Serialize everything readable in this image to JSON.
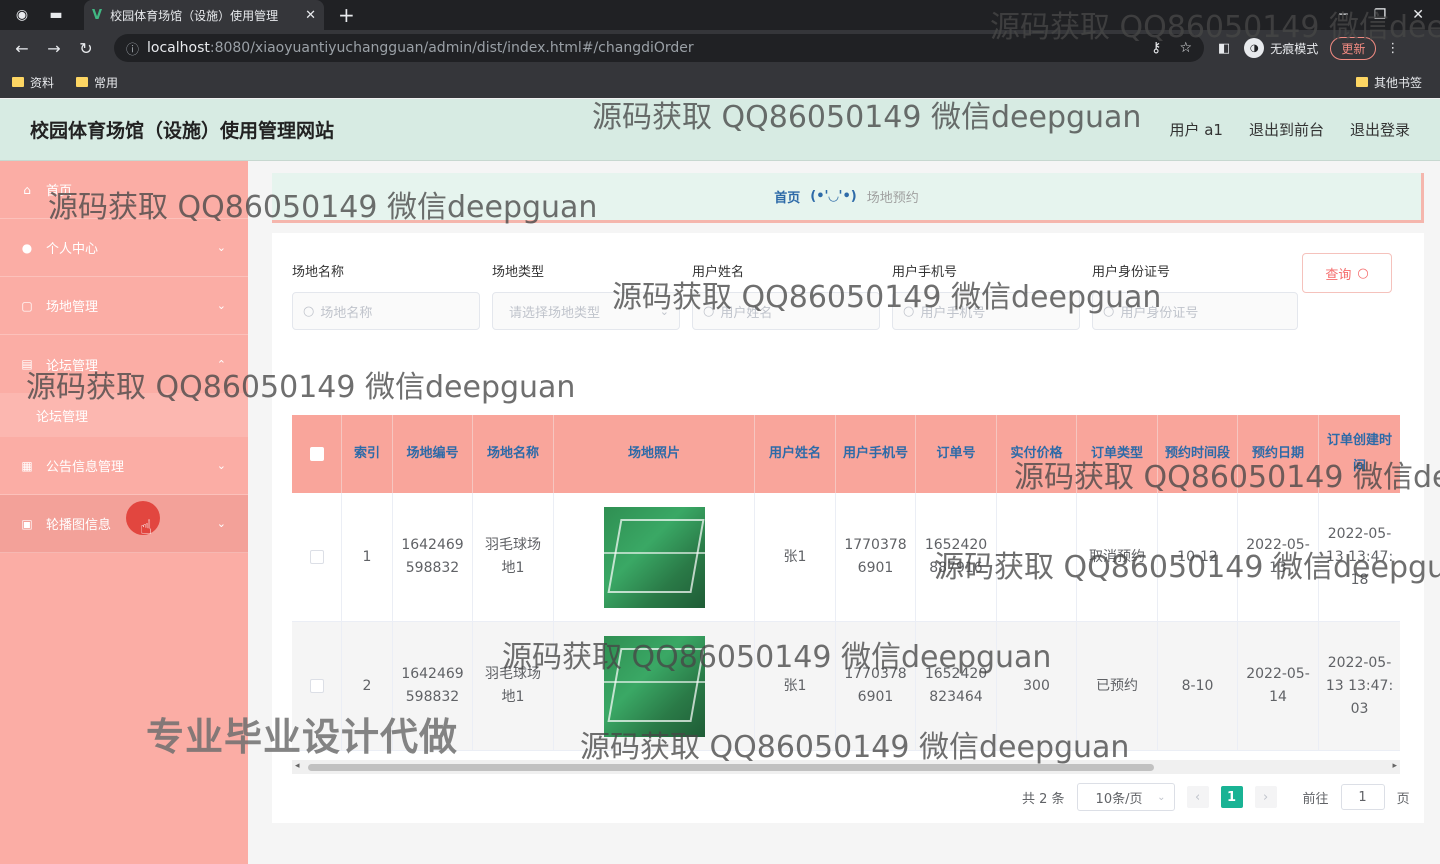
{
  "browser": {
    "tab_title": "校园体育场馆（设施）使用管理",
    "url_host": "localhost",
    "url_path": ":8080/xiaoyuantiyuchangguan/admin/dist/index.html#/changdiOrder",
    "incognito_label": "无痕模式",
    "update_label": "更新",
    "bookmarks": [
      "资料",
      "常用"
    ],
    "other_bookmarks": "其他书签"
  },
  "header": {
    "site_title": "校园体育场馆（设施）使用管理网站",
    "user_label": "用户 a1",
    "back_label": "退出到前台",
    "logout_label": "退出登录"
  },
  "sidebar": {
    "items": [
      {
        "label": "首页",
        "icon": "home-icon"
      },
      {
        "label": "个人中心",
        "icon": "user-icon"
      },
      {
        "label": "场地管理",
        "icon": "venue-icon"
      },
      {
        "label": "论坛管理",
        "icon": "forum-icon"
      },
      {
        "label": "公告信息管理",
        "icon": "grid-icon"
      },
      {
        "label": "轮播图信息",
        "icon": "image-icon"
      }
    ],
    "sub_item": "论坛管理"
  },
  "breadcrumb": {
    "home": "首页",
    "face": "(•'◡'•)",
    "current": "场地预约"
  },
  "filters": [
    {
      "label": "场地名称",
      "placeholder": "场地名称"
    },
    {
      "label": "场地类型",
      "placeholder": "请选择场地类型"
    },
    {
      "label": "用户姓名",
      "placeholder": "用户姓名"
    },
    {
      "label": "用户手机号",
      "placeholder": "用户手机号"
    },
    {
      "label": "用户身份证号",
      "placeholder": "用户身份证号"
    }
  ],
  "query_label": "查询",
  "table": {
    "headers": [
      "索引",
      "场地编号",
      "场地名称",
      "场地照片",
      "用户姓名",
      "用户手机号",
      "订单号",
      "实付价格",
      "订单类型",
      "预约时间段",
      "预约日期",
      "订单创建时间"
    ],
    "rows": [
      [
        "1",
        "1642469598832",
        "羽毛球场地1",
        "",
        "张1",
        "17703786901",
        "1652420887916",
        "",
        "取消预约",
        "10-12",
        "2022-05-13",
        "2022-05-13 13:47:18"
      ],
      [
        "2",
        "1642469598832",
        "羽毛球场地1",
        "",
        "张1",
        "17703786901",
        "1652420823464",
        "300",
        "已预约",
        "8-10",
        "2022-05-14",
        "2022-05-13 13:47:03"
      ]
    ]
  },
  "pagination": {
    "total": "共 2 条",
    "page_size": "10条/页",
    "current_page": "1",
    "goto_label": "前往",
    "goto_value": "1",
    "page_suffix": "页"
  },
  "watermark": "源码获取 QQ86050149 微信deepguan",
  "ad_text": "专业毕业设计代做"
}
